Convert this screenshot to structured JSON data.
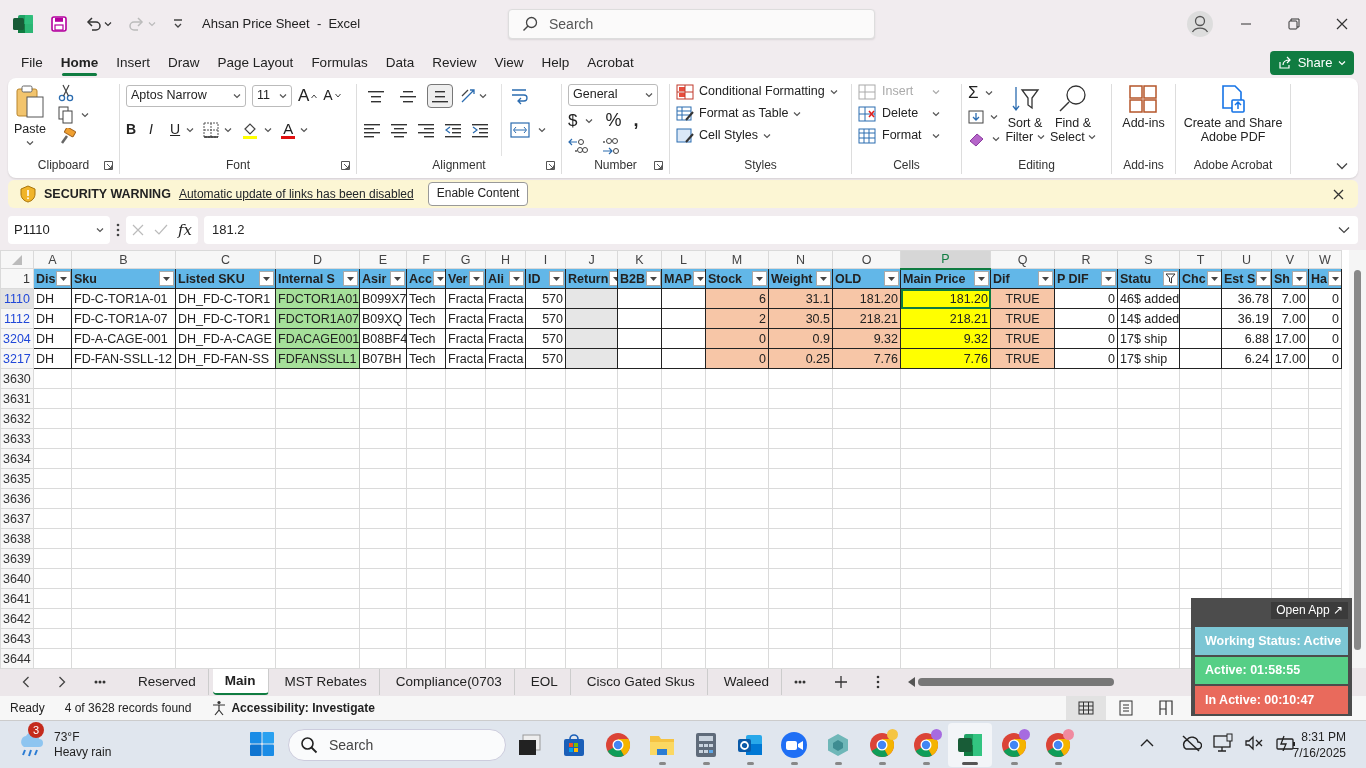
{
  "window": {
    "title": "Ahsan Price Sheet  -  Excel"
  },
  "quick_access": [
    {
      "kind": "save",
      "disabled": false
    },
    {
      "kind": "undo",
      "disabled": false
    },
    {
      "kind": "redo",
      "disabled": true
    }
  ],
  "search": {
    "placeholder": "Search"
  },
  "menu": [
    {
      "label": "File",
      "selected": false
    },
    {
      "label": "Home",
      "selected": true
    },
    {
      "label": "Insert",
      "selected": false
    },
    {
      "label": "Draw",
      "selected": false
    },
    {
      "label": "Page Layout",
      "selected": false
    },
    {
      "label": "Formulas",
      "selected": false
    },
    {
      "label": "Data",
      "selected": false
    },
    {
      "label": "Review",
      "selected": false
    },
    {
      "label": "View",
      "selected": false
    },
    {
      "label": "Help",
      "selected": false
    },
    {
      "label": "Acrobat",
      "selected": false
    }
  ],
  "share": {
    "label": "Share"
  },
  "ribbon": {
    "clipboard": {
      "paste": "Paste",
      "label": "Clipboard"
    },
    "font": {
      "name": "Aptos Narrow",
      "size": "11",
      "grow": "A",
      "shrink": "A",
      "bold": "B",
      "italic": "I",
      "underline": "U",
      "color_letter": "A",
      "label": "Font"
    },
    "alignment": {
      "label": "Alignment",
      "vertical": [
        {
          "kind": "top",
          "selected": false
        },
        {
          "kind": "middle",
          "selected": false
        },
        {
          "kind": "bottom",
          "selected": true
        }
      ]
    },
    "number": {
      "format": "General",
      "currency": "$",
      "percent": "%",
      "comma": ",",
      "label": "Number"
    },
    "styles": {
      "items": [
        "Conditional Formatting",
        "Format as Table",
        "Cell Styles"
      ],
      "label": "Styles"
    },
    "cells": {
      "items": [
        {
          "kind": "insert",
          "label": "Insert",
          "disabled": true
        },
        {
          "kind": "delete",
          "label": "Delete",
          "disabled": false
        },
        {
          "kind": "format",
          "label": "Format",
          "disabled": false
        }
      ],
      "label": "Cells"
    },
    "editing": {
      "sum": "Σ",
      "sort": "Sort & Filter",
      "find": "Find & Select",
      "label": "Editing"
    },
    "addins": {
      "button": "Add-ins",
      "label": "Add-ins"
    },
    "acrobat": {
      "button": "Create and Share Adobe PDF",
      "label": "Adobe Acrobat"
    }
  },
  "security": {
    "title": "SECURITY WARNING",
    "message": "Automatic update of links has been disabled",
    "button": "Enable Content"
  },
  "formula_bar": {
    "name_box": "P1110",
    "fx": "fx",
    "value": "181.2"
  },
  "sheet": {
    "header_row": "1",
    "columns": [
      {
        "letter": "A",
        "heading": "Dis",
        "filtered": false,
        "selected": false
      },
      {
        "letter": "B",
        "heading": "Sku",
        "filtered": false,
        "selected": false
      },
      {
        "letter": "C",
        "heading": "Listed SKU",
        "filtered": false,
        "selected": false
      },
      {
        "letter": "D",
        "heading": "Internal S",
        "filtered": false,
        "selected": false,
        "color": "#a6e09a"
      },
      {
        "letter": "E",
        "heading": "Asir",
        "filtered": false,
        "selected": false
      },
      {
        "letter": "F",
        "heading": "Acc",
        "filtered": false,
        "selected": false
      },
      {
        "letter": "G",
        "heading": "Ver",
        "filtered": false,
        "selected": false
      },
      {
        "letter": "H",
        "heading": "Ali",
        "filtered": false,
        "selected": false
      },
      {
        "letter": "I",
        "heading": "ID",
        "filtered": false,
        "selected": false
      },
      {
        "letter": "J",
        "heading": "Return",
        "filtered": false,
        "selected": false,
        "color": "#e6e6e6"
      },
      {
        "letter": "K",
        "heading": "B2B",
        "filtered": false,
        "selected": false
      },
      {
        "letter": "L",
        "heading": "MAP",
        "filtered": false,
        "selected": false
      },
      {
        "letter": "M",
        "heading": "Stock",
        "filtered": false,
        "selected": false,
        "color": "#f7c6a7"
      },
      {
        "letter": "N",
        "heading": "Weight",
        "filtered": false,
        "selected": false,
        "color": "#f7c6a7"
      },
      {
        "letter": "O",
        "heading": "OLD",
        "filtered": false,
        "selected": false,
        "color": "#f7c6a7"
      },
      {
        "letter": "P",
        "heading": "Main Price",
        "filtered": false,
        "selected": true,
        "color": "#ffff00"
      },
      {
        "letter": "Q",
        "heading": "Dif",
        "filtered": false,
        "selected": false,
        "color": "#f7c6a7"
      },
      {
        "letter": "R",
        "heading": "P DIF",
        "filtered": false,
        "selected": false
      },
      {
        "letter": "S",
        "heading": "Statu",
        "filtered": true,
        "selected": false
      },
      {
        "letter": "T",
        "heading": "Chc",
        "filtered": false,
        "selected": false
      },
      {
        "letter": "U",
        "heading": "Est S",
        "filtered": false,
        "selected": false
      },
      {
        "letter": "V",
        "heading": "Sh",
        "filtered": false,
        "selected": false
      },
      {
        "letter": "W",
        "heading": "Ha",
        "filtered": false,
        "selected": false
      }
    ],
    "rows": [
      {
        "number": "1110",
        "selected": true,
        "cells": [
          "DH",
          "FD-C-TOR1A-01",
          "DH_FD-C-TOR1",
          "FDCTOR1A01",
          "B099X7",
          "Tech",
          "Fracta",
          "Fracta",
          "570",
          null,
          null,
          null,
          "6",
          "31.1",
          "181.20",
          "181.20",
          "TRUE",
          "0",
          "46$ added",
          null,
          "36.78",
          "7.00",
          "0"
        ]
      },
      {
        "number": "1112",
        "selected": false,
        "cells": [
          "DH",
          "FD-C-TOR1A-07",
          "DH_FD-C-TOR1",
          "FDCTOR1A07",
          "B09XQ",
          "Tech",
          "Fracta",
          "Fracta",
          "570",
          null,
          null,
          null,
          "2",
          "30.5",
          "218.21",
          "218.21",
          "TRUE",
          "0",
          "14$ added",
          null,
          "36.19",
          "7.00",
          "0"
        ]
      },
      {
        "number": "3204",
        "selected": false,
        "cells": [
          "DH",
          "FD-A-CAGE-001",
          "DH_FD-A-CAGE",
          "FDACAGE001",
          "B08BF4",
          "Tech",
          "Fracta",
          "Fracta",
          "570",
          null,
          null,
          null,
          "0",
          "0.9",
          "9.32",
          "9.32",
          "TRUE",
          "0",
          "17$ ship",
          null,
          "6.88",
          "17.00",
          "0"
        ]
      },
      {
        "number": "3217",
        "selected": false,
        "cells": [
          "DH",
          "FD-FAN-SSLL-12",
          "DH_FD-FAN-SS",
          "FDFANSSLL1",
          "B07BH",
          "Tech",
          "Fracta",
          "Fracta",
          "570",
          null,
          null,
          null,
          "0",
          "0.25",
          "7.76",
          "7.76",
          "TRUE",
          "0",
          "17$ ship",
          null,
          "6.24",
          "17.00",
          "0"
        ]
      }
    ],
    "empty_rows": [
      "3630",
      "3631",
      "3632",
      "3633",
      "3634",
      "3635",
      "3636",
      "3637",
      "3638",
      "3639",
      "3640",
      "3641",
      "3642",
      "3643",
      "3644"
    ]
  },
  "sheet_tabs": [
    {
      "label": "Reserved",
      "selected": false
    },
    {
      "label": "Main",
      "selected": true
    },
    {
      "label": "MST Rebates",
      "selected": false
    },
    {
      "label": "Compliance(0703",
      "selected": false
    },
    {
      "label": "EOL",
      "selected": false
    },
    {
      "label": "Cisco Gated Skus",
      "selected": false
    },
    {
      "label": "Waleed",
      "selected": false
    }
  ],
  "status_bar": {
    "mode": "Ready",
    "records": "4 of 3628 records found",
    "accessibility": "Accessibility: Investigate",
    "views": [
      {
        "kind": "normal",
        "selected": true
      },
      {
        "kind": "page-layout",
        "selected": false
      },
      {
        "kind": "page-break",
        "selected": false
      }
    ]
  },
  "tracker": {
    "open": "Open App ↗",
    "status": "Working Status: Active",
    "active": "Active: 01:58:55",
    "inactive": "In Active: 00:10:47"
  },
  "taskbar": {
    "weather": {
      "badge": "3",
      "temperature": "73°F",
      "condition": "Heavy rain"
    },
    "search": {
      "placeholder": "Search"
    },
    "apps": [
      {
        "kind": "task-view",
        "running": false,
        "selected": false
      },
      {
        "kind": "store",
        "running": false,
        "selected": false
      },
      {
        "kind": "chrome",
        "running": false,
        "selected": false
      },
      {
        "kind": "explorer",
        "running": true,
        "selected": false
      },
      {
        "kind": "calculator",
        "running": true,
        "selected": false
      },
      {
        "kind": "outlook",
        "running": true,
        "selected": false
      },
      {
        "kind": "zoom",
        "running": true,
        "selected": false
      },
      {
        "kind": "cube",
        "running": true,
        "selected": false
      },
      {
        "kind": "chrome",
        "running": true,
        "selected": false,
        "color": "#f5c542"
      },
      {
        "kind": "chrome",
        "running": true,
        "selected": false,
        "color": "#a66be0"
      },
      {
        "kind": "excel",
        "running": true,
        "selected": true
      },
      {
        "kind": "chrome",
        "running": true,
        "selected": false,
        "color": "#a66be0"
      },
      {
        "kind": "chrome",
        "running": true,
        "selected": false,
        "color": "#f08aa0"
      }
    ],
    "time": "8:31 PM",
    "date": "7/16/2025"
  }
}
